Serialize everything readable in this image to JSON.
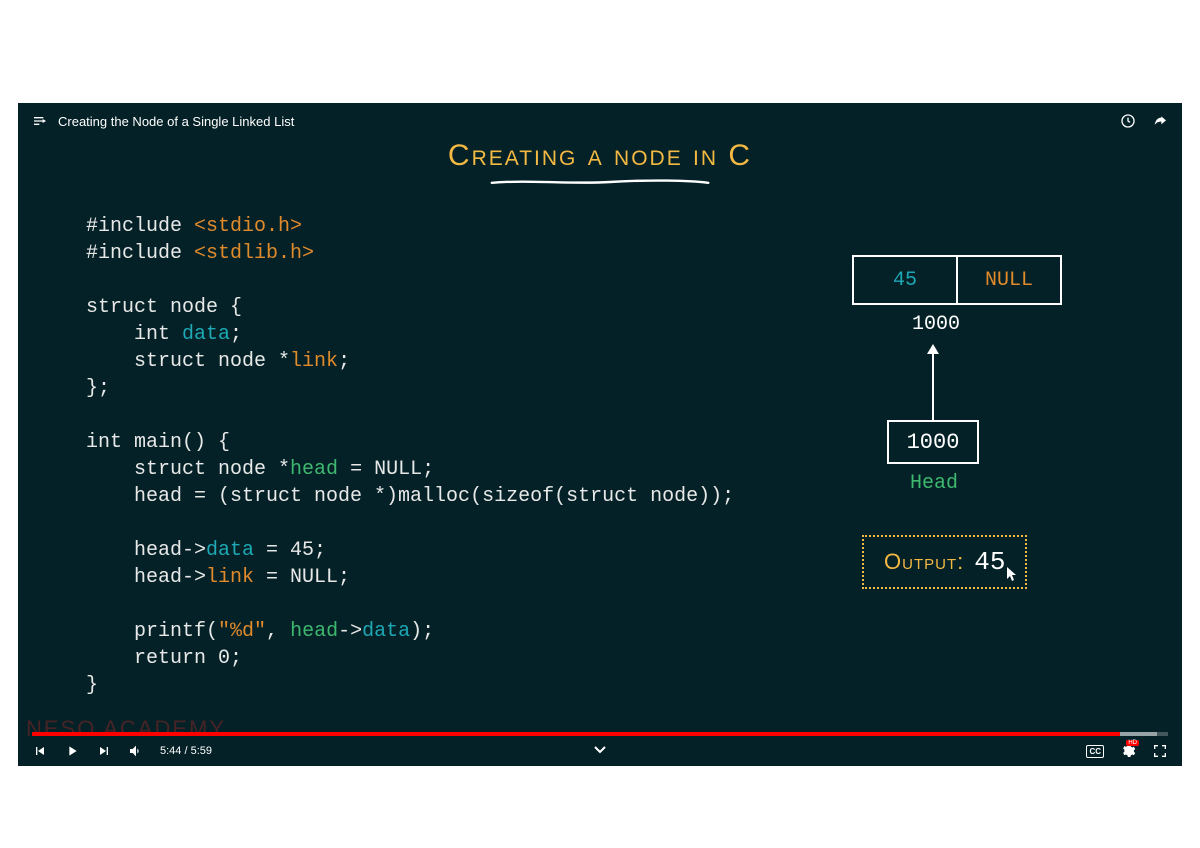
{
  "header": {
    "title": "Creating the Node of a Single Linked List"
  },
  "slide": {
    "heading": "Creating a node in C"
  },
  "code": {
    "l1a": "#include ",
    "l1b": "<stdio.h>",
    "l2a": "#include ",
    "l2b": "<stdlib.h>",
    "l3": "",
    "l4": "struct node {",
    "l5a": "    int ",
    "l5b": "data",
    "l5c": ";",
    "l6a": "    struct node *",
    "l6b": "link",
    "l6c": ";",
    "l7": "};",
    "l8": "",
    "l9": "int main() {",
    "l10a": "    struct node *",
    "l10b": "head",
    "l10c": " = NULL;",
    "l11": "    head = (struct node *)malloc(sizeof(struct node));",
    "l12": "",
    "l13a": "    head->",
    "l13b": "data",
    "l13c": " = 45;",
    "l14a": "    head->",
    "l14b": "link",
    "l14c": " = NULL;",
    "l15": "",
    "l16a": "    printf(",
    "l16b": "\"%d\"",
    "l16c": ", ",
    "l16d": "head",
    "l16e": "->",
    "l16f": "data",
    "l16g": ");",
    "l17": "    return 0;",
    "l18": "}"
  },
  "diagram": {
    "node_data": "45",
    "node_link": "NULL",
    "node_addr": "1000",
    "head_value": "1000",
    "head_label": "Head",
    "output_label": "Output:",
    "output_value": "45"
  },
  "watermark": "NESO ACADEMY",
  "playback": {
    "current": "5:44",
    "total": "5:59",
    "played_pct": 95.8,
    "buffered_pct": 99
  },
  "controls": {
    "cc": "CC",
    "hd": "HD"
  }
}
